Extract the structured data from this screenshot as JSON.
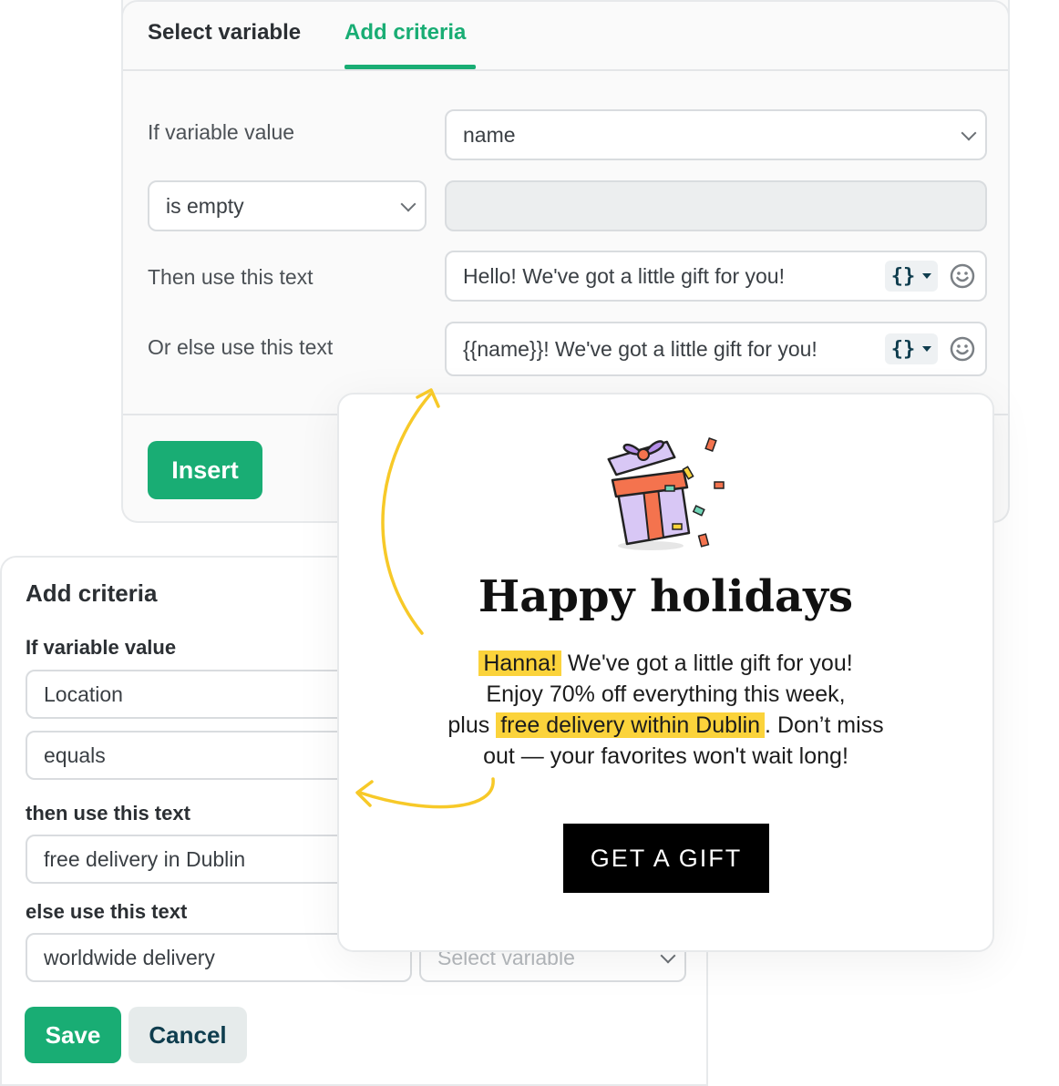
{
  "top_panel": {
    "tabs": [
      {
        "label": "Select variable",
        "active": false
      },
      {
        "label": "Add criteria",
        "active": true
      }
    ],
    "if_label": "If variable value",
    "variable_select": "name",
    "condition_select": "is empty",
    "condition_value": "",
    "then_label": "Then use this text",
    "then_text": "Hello! We've got a little gift for you!",
    "else_label": "Or else use this text",
    "else_text": "{{name}}! We've got a little gift for you!",
    "var_tool_glyph": "{}",
    "insert_button": "Insert"
  },
  "left_panel": {
    "title": "Add criteria",
    "if_label": "If variable value",
    "variable_field": "Location",
    "condition_field": "equals",
    "then_label": "then use this text",
    "then_field": "free delivery in Dublin",
    "else_label": "else use this text",
    "else_field": "worldwide delivery",
    "else_variable_placeholder": "Select variable",
    "save_button": "Save",
    "cancel_button": "Cancel"
  },
  "email_card": {
    "title": "Happy holidays",
    "highlight_name": "Hanna!",
    "line1_rest": "We've got a little gift for you!",
    "line2": "Enjoy 70% off everything this week,",
    "line3_start": "plus",
    "highlight_delivery": "free delivery within Dublin",
    "line3_end": ". Don’t miss",
    "line4": "out — your favorites won't wait long!",
    "cta_button": "GET A GIFT"
  },
  "colors": {
    "accent_green": "#19ad74",
    "highlight_yellow": "#fbd33b",
    "arrow_yellow": "#f7c928",
    "dark_teal": "#0f3d4e"
  }
}
